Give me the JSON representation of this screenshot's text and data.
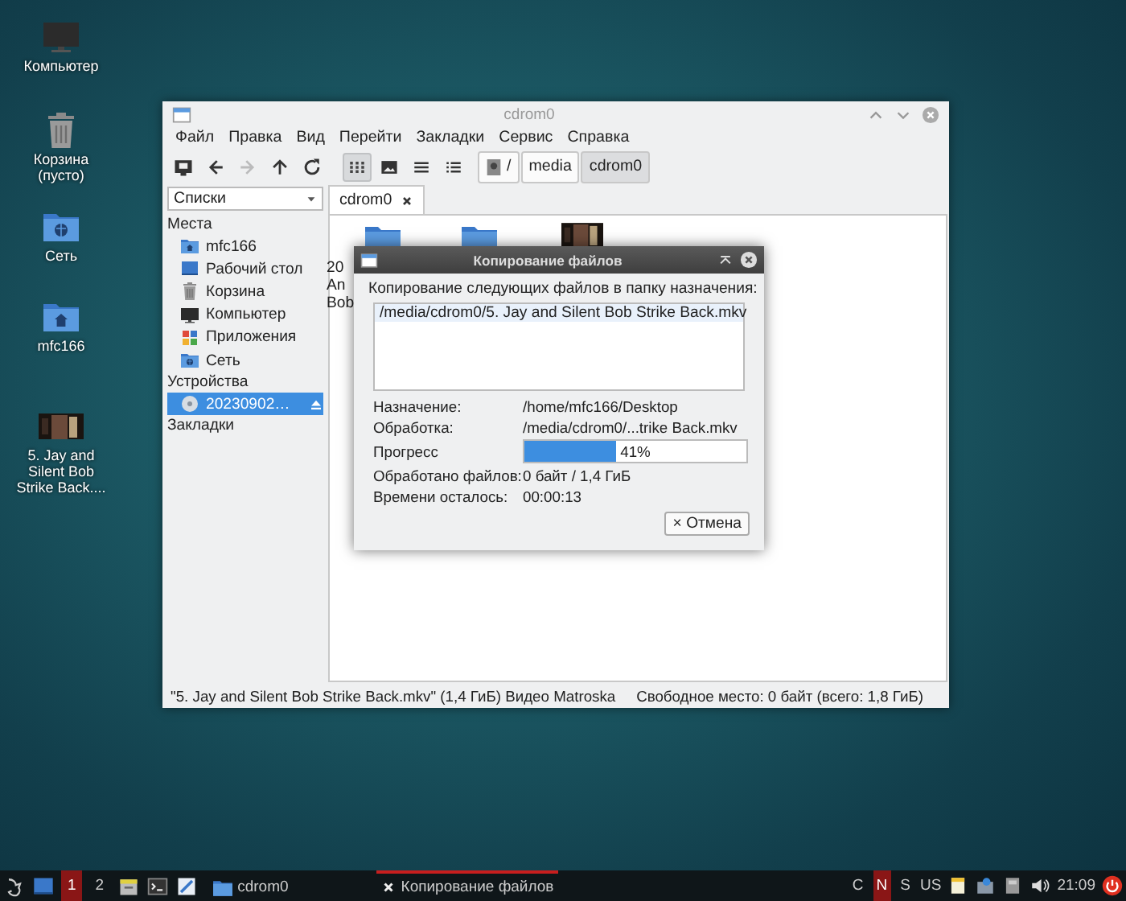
{
  "desktop_icons": [
    {
      "kind": "computer",
      "label": "Компьютер"
    },
    {
      "kind": "trash",
      "label": "Корзина (пусто)"
    },
    {
      "kind": "network",
      "label": "Сеть"
    },
    {
      "kind": "home",
      "label": "mfc166"
    },
    {
      "kind": "video",
      "label": "5. Jay and Silent Bob Strike Back...."
    }
  ],
  "file_manager": {
    "title": "cdrom0",
    "menu": [
      "Файл",
      "Правка",
      "Вид",
      "Перейти",
      "Закладки",
      "Сервис",
      "Справка"
    ],
    "nav_buttons": [
      {
        "kind": "new-window",
        "disabled": false
      },
      {
        "kind": "back",
        "disabled": false
      },
      {
        "kind": "forward",
        "disabled": true
      },
      {
        "kind": "up",
        "disabled": false
      },
      {
        "kind": "reload",
        "disabled": false
      }
    ],
    "view_buttons": [
      {
        "kind": "icons",
        "selected": true
      },
      {
        "kind": "thumbnails",
        "selected": false
      },
      {
        "kind": "compact",
        "selected": false
      },
      {
        "kind": "details",
        "selected": false
      }
    ],
    "path": [
      {
        "label": "/",
        "selected": false
      },
      {
        "label": "media",
        "selected": false
      },
      {
        "label": "cdrom0",
        "selected": true
      }
    ],
    "side_pane_mode": "Списки",
    "sidebar": [
      {
        "heading": "Места",
        "items": [
          {
            "kind": "home",
            "label": "mfc166",
            "selected": false
          },
          {
            "kind": "desktop",
            "label": "Рабочий стол",
            "selected": false
          },
          {
            "kind": "trash",
            "label": "Корзина",
            "selected": false
          },
          {
            "kind": "computer",
            "label": "Компьютер",
            "selected": false
          },
          {
            "kind": "apps",
            "label": "Приложения",
            "selected": false
          },
          {
            "kind": "network",
            "label": "Сеть",
            "selected": false
          }
        ]
      },
      {
        "heading": "Устройства",
        "items": [
          {
            "kind": "disc",
            "label": "20230902…",
            "selected": true
          }
        ]
      },
      {
        "heading": "Закладки"
      }
    ],
    "tabs": [
      {
        "label": "cdrom0",
        "selected": true
      }
    ],
    "files": [
      {
        "kind": "folder",
        "label_lines": [
          "20",
          "An",
          "Bob"
        ]
      },
      {
        "kind": "folder"
      },
      {
        "kind": "video"
      }
    ],
    "status_bar": {
      "selection": "\"5. Jay and Silent Bob Strike Back.mkv\" (1,4 ГиБ) Видео Matroska",
      "free_space": "Свободное место: 0 байт (всего: 1,8 ГиБ)"
    }
  },
  "copy_dialog": {
    "title": "Копирование файлов",
    "prompt": "Копирование следующих файлов в папку назначения:",
    "files": [
      "/media/cdrom0/5. Jay and Silent Bob Strike Back.mkv"
    ],
    "fields": [
      {
        "kind": "text",
        "label": "Назначение:",
        "value": "/home/mfc166/Desktop"
      },
      {
        "kind": "text",
        "label": "Обработка:",
        "value": "/media/cdrom0/...trike Back.mkv"
      },
      {
        "kind": "progress",
        "label": "Прогресс",
        "level": 0.41,
        "value": "41%"
      },
      {
        "kind": "text",
        "label": "Обработано файлов:",
        "value": "0 байт / 1,4 ГиБ"
      },
      {
        "kind": "text",
        "label": "Времени осталось:",
        "value": "00:00:13"
      }
    ],
    "cancel_button": {
      "icon": "×",
      "label": "Отмена"
    }
  },
  "taskbar": {
    "launchers": [
      {
        "kind": "menu"
      },
      {
        "kind": "desktop"
      }
    ],
    "workspaces": [
      {
        "label": "1",
        "selected": true
      },
      {
        "label": "2",
        "selected": false
      }
    ],
    "quick_launch": [
      {
        "kind": "file-manager"
      },
      {
        "kind": "terminal"
      },
      {
        "kind": "editor"
      }
    ],
    "tasks": [
      {
        "kind": "folder",
        "label": "cdrom0",
        "selected": false
      },
      {
        "kind": "close",
        "label": "Копирование файлов",
        "selected": true
      }
    ],
    "keyboard_indicators": [
      {
        "label": "C",
        "on": false
      },
      {
        "label": "N",
        "on": true
      },
      {
        "label": "S",
        "on": false
      }
    ],
    "keyboard_layout": "US",
    "tray": [
      {
        "kind": "notes"
      },
      {
        "kind": "chat"
      },
      {
        "kind": "drive"
      },
      {
        "kind": "volume"
      }
    ],
    "clock": "21:09"
  }
}
